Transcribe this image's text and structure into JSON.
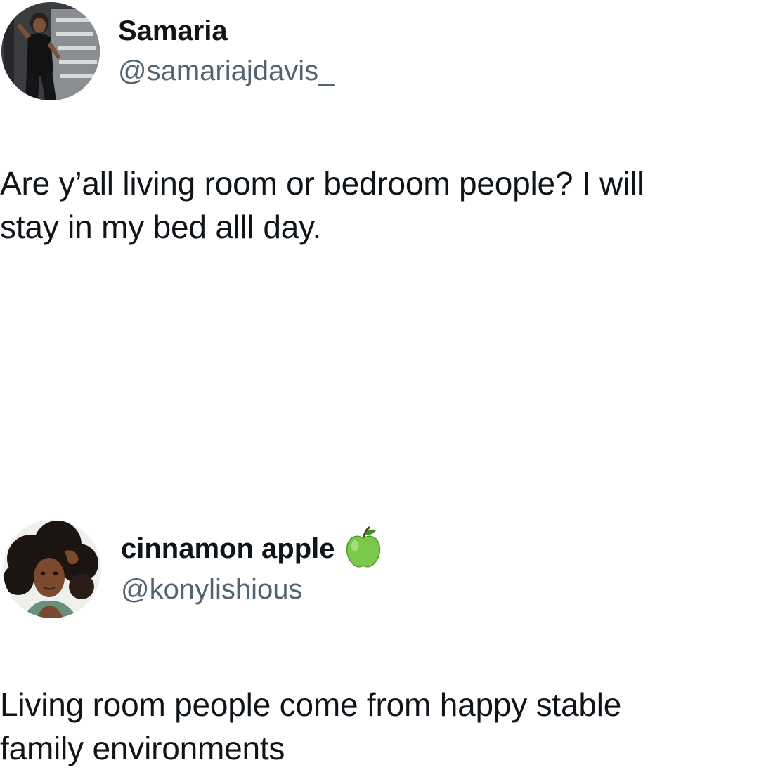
{
  "tweets": [
    {
      "display_name": "Samaria",
      "handle": "@samariajdavis_",
      "text_lines": [
        "Are y’all living room or bedroom people? I will",
        "stay in my bed alll day."
      ],
      "avatar": "profile-photo-woman-black-outfit"
    },
    {
      "display_name": "cinnamon apple",
      "name_emoji": "green-apple-icon",
      "handle": "@konylishious",
      "text_lines": [
        "Living room people come from happy stable",
        "family environments"
      ],
      "avatar": "profile-photo-woman-curly-hair"
    }
  ],
  "colors": {
    "text": "#0f1419",
    "secondary_text": "#536471",
    "background": "#ffffff",
    "apple_green": "#7cc84a"
  }
}
